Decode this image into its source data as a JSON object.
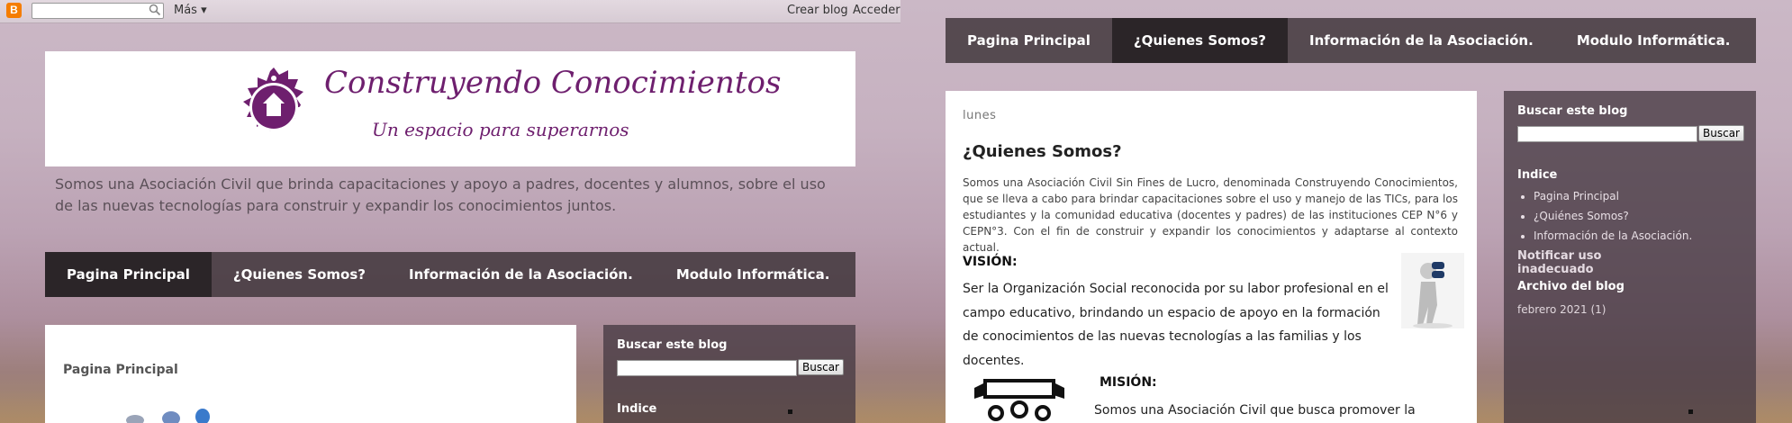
{
  "navbar": {
    "logo_letter": "B",
    "search_placeholder": "",
    "more_label": "Más ▾",
    "create_blog": "Crear blog",
    "sign_in": "Acceder"
  },
  "header": {
    "title": "Construyendo Conocimientos",
    "subtitle": "Un espacio para superarnos",
    "description": "Somos una Asociación Civil que brinda capacitaciones y apoyo a padres, docentes y alumnos, sobre el uso de las nuevas tecnologías para construir y expandir los conocimientos juntos."
  },
  "tabs": [
    {
      "label": "Pagina Principal"
    },
    {
      "label": "¿Quienes Somos?"
    },
    {
      "label": "Información de la Asociación."
    },
    {
      "label": "Modulo Informática."
    }
  ],
  "left": {
    "post_title": "Pagina Principal",
    "sidebar": {
      "search_title": "Buscar este blog",
      "search_button": "Buscar",
      "index_title": "Indice"
    }
  },
  "right": {
    "post": {
      "day": "lunes",
      "title": "¿Quienes Somos?",
      "intro": " Somos una Asociación Civil Sin Fines de Lucro, denominada Construyendo Conocimientos, que se lleva a cabo para brindar capacitaciones sobre el uso y manejo de las TICs, para los estudiantes y la comunidad educativa (docentes y padres) de las instituciones CEP N°6 y CEPN°3. Con el fin de construir y expandir los conocimientos y adaptarse al contexto actual.",
      "vision_title": "VISIÓN:",
      "vision_text": "Ser la Organización Social reconocida por su labor profesional en el campo educativo, brindando un espacio de  apoyo en la formación de conocimientos de las nuevas tecnologías a las familias y los docentes.",
      "mission_title": "MISIÓN:",
      "mission_text": "Somos una Asociación Civil que busca promover la"
    },
    "sidebar": {
      "search_title": "Buscar este blog",
      "search_button": "Buscar",
      "index_title": "Indice",
      "index_items": [
        "Pagina Principal",
        "¿Quiénes Somos?",
        "Información de la Asociación."
      ],
      "report_title": "Notificar uso inadecuado",
      "archive_title": "Archivo del blog",
      "archive_item": "febrero 2021 (1)"
    }
  },
  "colors": {
    "brand_purple": "#6e1f6e",
    "tab_bar": "#3c3237",
    "tab_active": "#2b2528",
    "blogger_orange": "#f57d00"
  }
}
